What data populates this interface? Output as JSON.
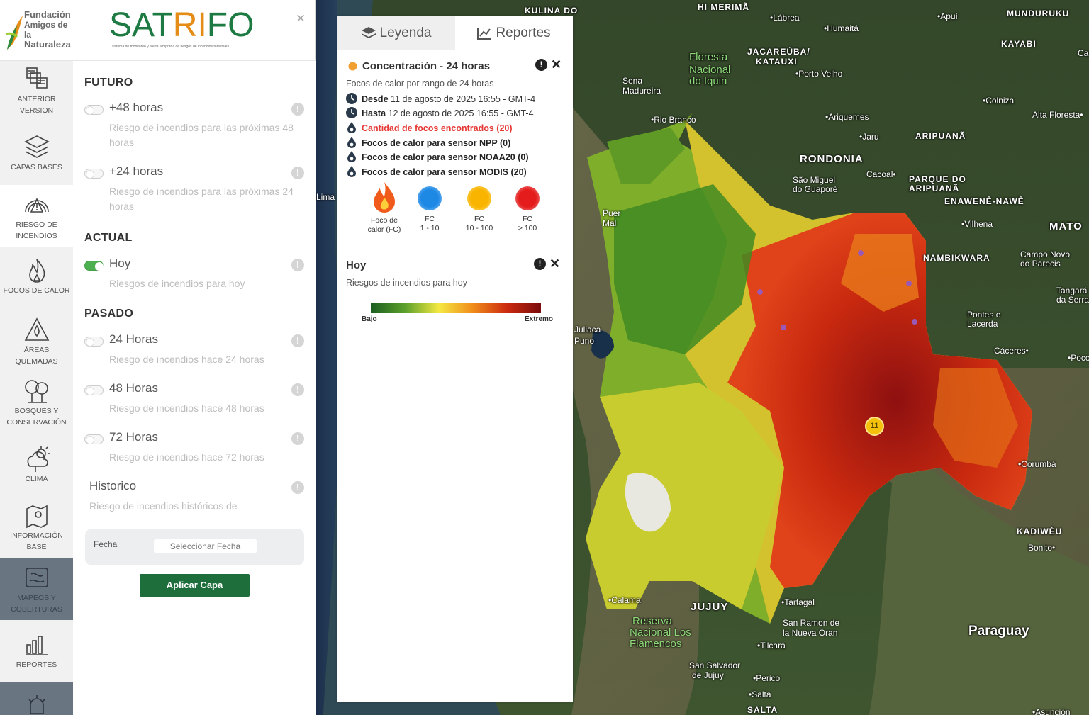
{
  "brand": {
    "foundation_lines": [
      "Fundación",
      "Amigos de la",
      "Naturaleza"
    ],
    "app_name_left": "SAT",
    "app_name_mid": "RI",
    "app_name_right": "FO",
    "app_subtitle": "sistema de monitoreo y alerta temprana de riesgos de incendios forestales",
    "close_glyph": "×"
  },
  "nav": {
    "items": [
      {
        "label": "ANTERIOR VERSION",
        "icon": "grid-layers-icon"
      },
      {
        "label": "CAPAS BASES",
        "icon": "stacked-layers-icon"
      },
      {
        "label": "RIESGO DE INCENDIOS",
        "icon": "fire-danger-gauge-icon"
      },
      {
        "label": "FOCOS DE CALOR",
        "icon": "flame-icon"
      },
      {
        "label": "ÁREAS QUEMADAS",
        "icon": "burned-area-icon"
      },
      {
        "label": "BOSQUES Y CONSERVACIÓN",
        "icon": "trees-icon"
      },
      {
        "label": "CLIMA",
        "icon": "weather-icon"
      },
      {
        "label": "INFORMACIÓN BASE",
        "icon": "map-pin-icon"
      },
      {
        "label": "MAPEOS Y COBERTURAS",
        "icon": "map-scroll-icon"
      },
      {
        "label": "REPORTES",
        "icon": "reports-chart-icon"
      }
    ]
  },
  "layers": {
    "futuro_title": "FUTURO",
    "actual_title": "ACTUAL",
    "pasado_title": "PASADO",
    "items": [
      {
        "name": "+48 horas",
        "desc": "Riesgo de incendios para las próximas 48 horas",
        "on": false
      },
      {
        "name": "+24 horas",
        "desc": "Riesgo de incendios para las próximas 24 horas",
        "on": false
      },
      {
        "name": "Hoy",
        "desc": "Riesgos de incendios para hoy",
        "on": true
      },
      {
        "name": "24 Horas",
        "desc": "Riesgo de incendios hace 24 horas",
        "on": false
      },
      {
        "name": "48 Horas",
        "desc": "Riesgo de incendios hace 48 horas",
        "on": false
      },
      {
        "name": "72 Horas",
        "desc": "Riesgo de incendios hace 72 horas",
        "on": false
      }
    ],
    "historico": {
      "name": "Historico",
      "desc": "Riesgo de incendios históricos de"
    },
    "fecha_label": "Fecha",
    "fecha_placeholder": "Seleccionar Fecha",
    "apply_label": "Aplicar Capa",
    "info_glyph": "!"
  },
  "legend_panel": {
    "tab_leyenda": "Leyenda",
    "tab_reportes": "Reportes",
    "concentracion": {
      "title": "Concentración - 24 horas",
      "subtitle": "Focos de calor por rango de 24 horas",
      "desde_label": "Desde",
      "desde_value": "11 de agosto de 2025 16:55 - GMT-4",
      "hasta_label": "Hasta",
      "hasta_value": "12 de agosto de 2025 16:55 - GMT-4",
      "cantidad": "Cantidad de focos encontrados (20)",
      "npp": "Focos de calor para sensor NPP (0)",
      "noaa20": "Focos de calor para sensor NOAA20 (0)",
      "modis": "Focos de calor para sensor MODIS (20)",
      "legend_items": [
        {
          "line1": "Foco de",
          "line2": "calor (FC)",
          "color": "#f05a1a"
        },
        {
          "line1": "FC",
          "line2": "1 - 10",
          "color": "#1e88e5"
        },
        {
          "line1": "FC",
          "line2": "10 - 100",
          "color": "#f9b400"
        },
        {
          "line1": "FC",
          "line2": "> 100",
          "color": "#e51c1c"
        }
      ]
    },
    "hoy": {
      "title": "Hoy",
      "subtitle": "Riesgos de incendios para hoy",
      "low": "Bajo",
      "high": "Extremo"
    },
    "close_glyph": "✕",
    "info_glyph": "!"
  },
  "map": {
    "cluster_count": "11",
    "labels": [
      {
        "text": "KULINA DO",
        "cls": "bold"
      },
      {
        "text": "HI MERIMÃ",
        "cls": "bold"
      },
      {
        "text": "•Lábrea",
        "cls": ""
      },
      {
        "text": "•Humaitá",
        "cls": ""
      },
      {
        "text": "•Apuí",
        "cls": ""
      },
      {
        "text": "MUNDURUKU",
        "cls": "bold"
      },
      {
        "text": "KAYABI",
        "cls": "bold"
      },
      {
        "text": "Floresta",
        "cls": "green"
      },
      {
        "text": "Nacional",
        "cls": "green"
      },
      {
        "text": "do Iquiri",
        "cls": "green"
      },
      {
        "text": "JACAREÚBA/",
        "cls": "bold"
      },
      {
        "text": "KATAUXI",
        "cls": "bold"
      },
      {
        "text": "•Porto Velho",
        "cls": ""
      },
      {
        "text": "Sena",
        "cls": ""
      },
      {
        "text": "Madureira",
        "cls": ""
      },
      {
        "text": "•Colniza",
        "cls": ""
      },
      {
        "text": "•Rio Branco",
        "cls": ""
      },
      {
        "text": "•Ariquemes",
        "cls": ""
      },
      {
        "text": "Alta Floresta•",
        "cls": ""
      },
      {
        "text": "•Jaru",
        "cls": ""
      },
      {
        "text": "ARIPUANÃ",
        "cls": "bold"
      },
      {
        "text": "RONDONIA",
        "cls": "big"
      },
      {
        "text": "Cacoal•",
        "cls": ""
      },
      {
        "text": "São Miguel",
        "cls": ""
      },
      {
        "text": "do Guaporé",
        "cls": ""
      },
      {
        "text": "PARQUE DO",
        "cls": "bold"
      },
      {
        "text": "ARIPUANÃ",
        "cls": "bold"
      },
      {
        "text": "ENAWENÊ-NAWÊ",
        "cls": "bold"
      },
      {
        "text": "•Vilhena",
        "cls": ""
      },
      {
        "text": "MATO",
        "cls": "big"
      },
      {
        "text": "NAMBIKWARA",
        "cls": "bold"
      },
      {
        "text": "Campo Novo",
        "cls": ""
      },
      {
        "text": "do Parecis",
        "cls": ""
      },
      {
        "text": "Tangará",
        "cls": ""
      },
      {
        "text": "da Serra",
        "cls": ""
      },
      {
        "text": "Pontes e",
        "cls": ""
      },
      {
        "text": "Lacerda",
        "cls": ""
      },
      {
        "text": "Cáceres•",
        "cls": ""
      },
      {
        "text": "•Corumbá",
        "cls": ""
      },
      {
        "text": "KADIWÉU",
        "cls": "bold"
      },
      {
        "text": "Bonito•",
        "cls": ""
      },
      {
        "text": "Paraguay",
        "cls": "country"
      },
      {
        "text": "JUJUY",
        "cls": "big"
      },
      {
        "text": "Reserva",
        "cls": "green"
      },
      {
        "text": "Nacional Los",
        "cls": "green"
      },
      {
        "text": "Flamencos",
        "cls": "green"
      },
      {
        "text": "•Calama",
        "cls": ""
      },
      {
        "text": "•Tartagal",
        "cls": ""
      },
      {
        "text": "San Ramon de",
        "cls": ""
      },
      {
        "text": "la Nueva Oran",
        "cls": ""
      },
      {
        "text": "•Tilcara",
        "cls": ""
      },
      {
        "text": "San Salvador",
        "cls": ""
      },
      {
        "text": "de Jujuy",
        "cls": ""
      },
      {
        "text": "•Perico",
        "cls": ""
      },
      {
        "text": "•Salta",
        "cls": ""
      },
      {
        "text": "Lima",
        "cls": ""
      },
      {
        "text": "Juliaca",
        "cls": ""
      },
      {
        "text": "Puno",
        "cls": ""
      },
      {
        "text": "Puer",
        "cls": ""
      },
      {
        "text": "Mal",
        "cls": ""
      },
      {
        "text": "SALTA",
        "cls": "bold"
      },
      {
        "text": "•Asunción",
        "cls": ""
      },
      {
        "text": "•Poco",
        "cls": ""
      },
      {
        "text": "Cast",
        "cls": ""
      }
    ]
  },
  "colors": {
    "accent_green": "#1e6e3c",
    "logo_orange": "#e58c16",
    "toggle_on": "#4caf50",
    "alert_red": "#e53935"
  }
}
